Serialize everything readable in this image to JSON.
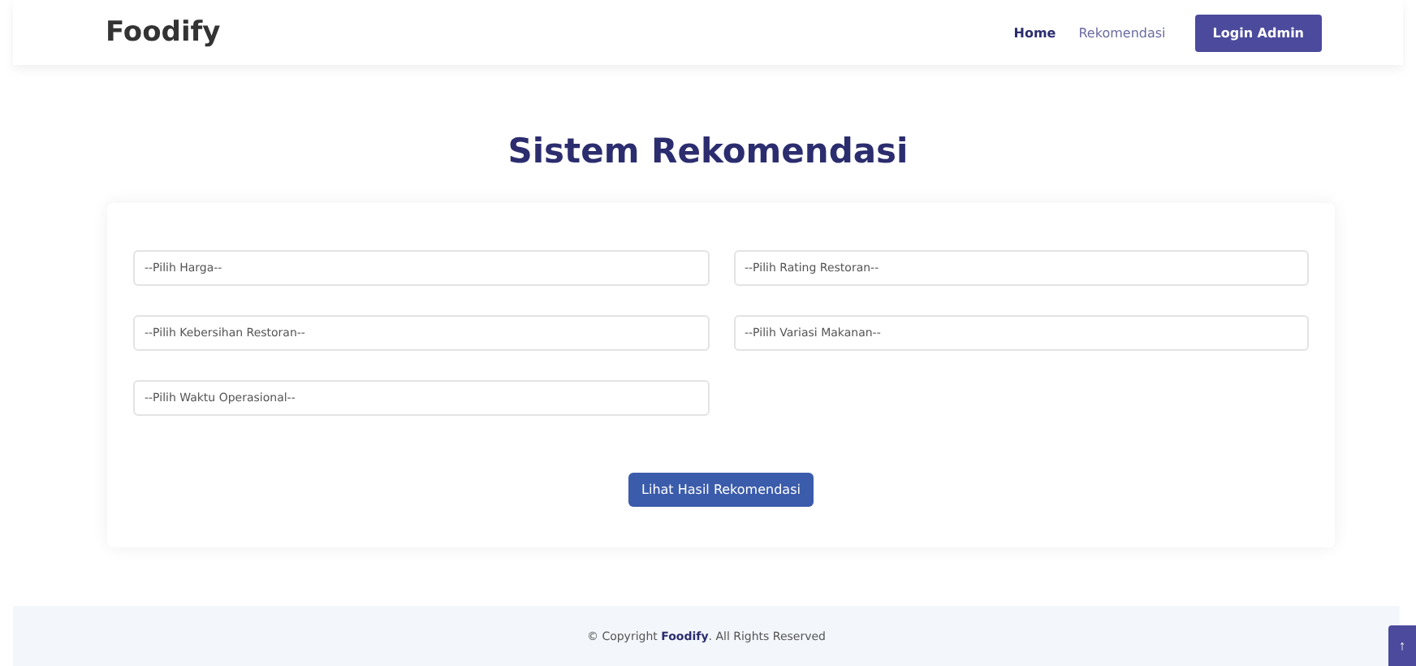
{
  "navbar": {
    "brand": "Foodify",
    "links": [
      {
        "label": "Home",
        "selected": true
      },
      {
        "label": "Rekomendasi",
        "selected": false
      }
    ],
    "login_button": "Login Admin"
  },
  "title": "Sistem Rekomendasi",
  "fields": [
    {
      "placeholder": "--Pilih Harga--"
    },
    {
      "placeholder": "--Pilih Rating Restoran--"
    },
    {
      "placeholder": "--Pilih Kebersihan Restoran--"
    },
    {
      "placeholder": "--Pilih Variasi Makanan--"
    },
    {
      "placeholder": "--Pilih Waktu Operasional--"
    }
  ],
  "submit_button": "Lihat Hasil Rekomendasi",
  "footer": {
    "copyright": "© Copyright **Foodify**. All Rights Reserved"
  },
  "back_to_top": "↑"
}
